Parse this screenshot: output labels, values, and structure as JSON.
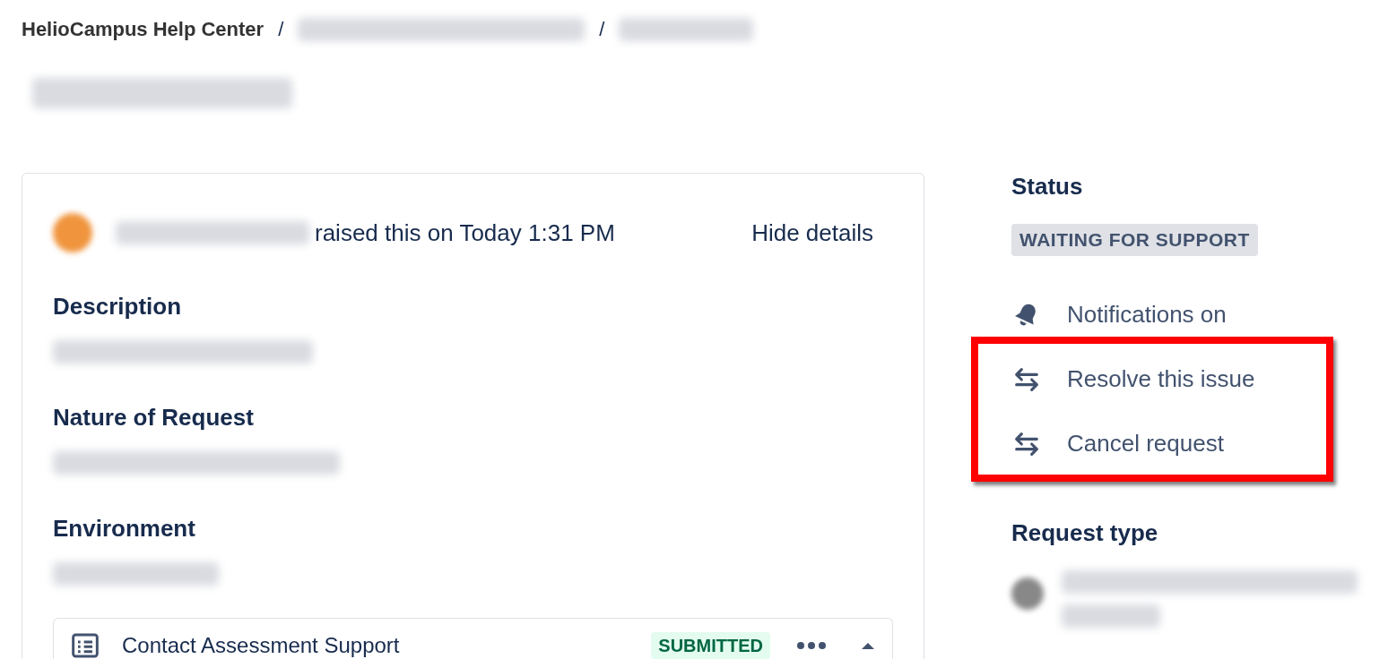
{
  "breadcrumb": {
    "home": "HelioCampus Help Center",
    "separators": [
      "/",
      "/"
    ]
  },
  "request": {
    "raised_text": "raised this on Today 1:31 PM",
    "details_toggle": "Hide details",
    "fields": [
      {
        "label": "Description"
      },
      {
        "label": "Nature of Request"
      },
      {
        "label": "Environment"
      }
    ],
    "linked_item": {
      "title": "Contact Assessment Support",
      "status": "SUBMITTED"
    }
  },
  "sidebar": {
    "status_heading": "Status",
    "status": "WAITING FOR SUPPORT",
    "highlight": true,
    "actions": [
      {
        "kind": "notification",
        "label": "Notifications on"
      },
      {
        "kind": "transition",
        "label": "Resolve this issue"
      },
      {
        "kind": "transition",
        "label": "Cancel request"
      }
    ],
    "request_type_heading": "Request type"
  }
}
